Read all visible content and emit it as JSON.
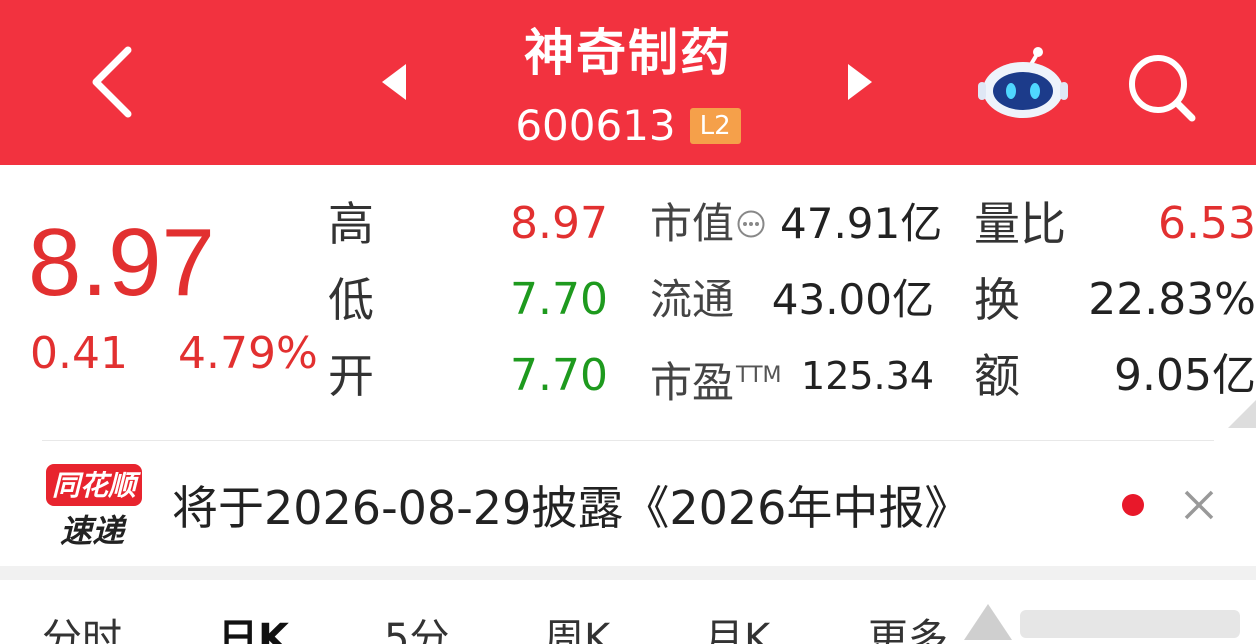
{
  "header": {
    "stock_name": "神奇制药",
    "stock_code": "600613",
    "level_badge": "L2",
    "icons": {
      "back": "chevron-left-icon",
      "prev": "triangle-left-icon",
      "next": "triangle-right-icon",
      "assistant": "robot-icon",
      "search": "search-icon"
    }
  },
  "quote": {
    "price": "8.97",
    "change": "0.41",
    "change_pct": "4.79%",
    "high_label": "高",
    "high_value": "8.97",
    "low_label": "低",
    "low_value": "7.70",
    "open_label": "开",
    "open_value": "7.70",
    "market_cap_label": "市值",
    "market_cap_value": "47.91亿",
    "float_cap_label": "流通",
    "float_cap_value": "43.00亿",
    "pe_label": "市盈",
    "pe_suffix": "TTM",
    "pe_value": "125.34",
    "volume_ratio_label": "量比",
    "volume_ratio_value": "6.53",
    "turnover_label": "换",
    "turnover_value": "22.83%",
    "amount_label": "额",
    "amount_value": "9.05亿"
  },
  "news": {
    "logo_top": "同花顺",
    "logo_bottom": "速递",
    "text": "将于2026-08-29披露《2026年中报》"
  },
  "tabs": [
    {
      "label": "分时",
      "active": false
    },
    {
      "label": "日K",
      "active": true
    },
    {
      "label": "5分",
      "active": false
    },
    {
      "label": "周K",
      "active": false
    },
    {
      "label": "月K",
      "active": false
    },
    {
      "label": "更多",
      "active": false
    }
  ],
  "colors": {
    "header_bg": "#f2323f",
    "up_red": "#e23030",
    "down_green": "#1e9a1e",
    "badge_orange": "#f5a04a"
  }
}
